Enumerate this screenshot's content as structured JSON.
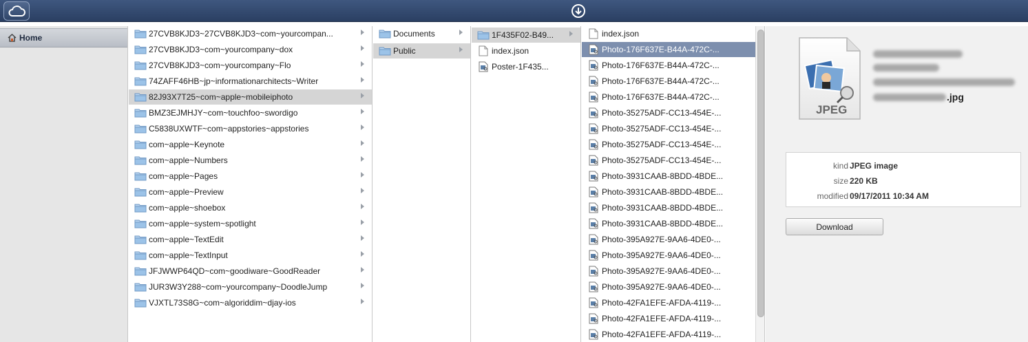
{
  "topbar": {
    "cloud_icon": "cloud-icon",
    "download_icon": "download-circle-icon"
  },
  "sidebar": {
    "home_label": "Home",
    "home_icon": "home-icon"
  },
  "columns": {
    "col1": {
      "selected_index": 4,
      "items": [
        "27CVB8KJD3~27CVB8KJD3~com~yourcompan...",
        "27CVB8KJD3~com~yourcompany~dox",
        "27CVB8KJD3~com~yourcompany~Flo",
        "74ZAFF46HB~jp~informationarchitects~Writer",
        "82J93X7T25~com~apple~mobileiphoto",
        "BMZ3EJMHJY~com~touchfoo~swordigo",
        "C5838UXWTF~com~appstories~appstories",
        "com~apple~Keynote",
        "com~apple~Numbers",
        "com~apple~Pages",
        "com~apple~Preview",
        "com~apple~shoebox",
        "com~apple~system~spotlight",
        "com~apple~TextEdit",
        "com~apple~TextInput",
        "JFJWWP64QD~com~goodiware~GoodReader",
        "JUR3W3Y288~com~yourcompany~DoodleJump",
        "VJXTL73S8G~com~algoriddim~djay-ios"
      ]
    },
    "col2": {
      "selected_index": 1,
      "items": [
        "Documents",
        "Public"
      ]
    },
    "col3": {
      "items": [
        {
          "label": "1F435F02-B49...",
          "kind": "folder"
        },
        {
          "label": "index.json",
          "kind": "file"
        },
        {
          "label": "Poster-1F435...",
          "kind": "image"
        }
      ]
    },
    "col4": {
      "selected_index": 1,
      "items": [
        {
          "label": "index.json",
          "kind": "file"
        },
        {
          "label": "Photo-176F637E-B44A-472C-...",
          "kind": "image"
        },
        {
          "label": "Photo-176F637E-B44A-472C-...",
          "kind": "image"
        },
        {
          "label": "Photo-176F637E-B44A-472C-...",
          "kind": "image"
        },
        {
          "label": "Photo-176F637E-B44A-472C-...",
          "kind": "image"
        },
        {
          "label": "Photo-35275ADF-CC13-454E-...",
          "kind": "image"
        },
        {
          "label": "Photo-35275ADF-CC13-454E-...",
          "kind": "image"
        },
        {
          "label": "Photo-35275ADF-CC13-454E-...",
          "kind": "image"
        },
        {
          "label": "Photo-35275ADF-CC13-454E-...",
          "kind": "image"
        },
        {
          "label": "Photo-3931CAAB-8BDD-4BDE...",
          "kind": "image"
        },
        {
          "label": "Photo-3931CAAB-8BDD-4BDE...",
          "kind": "image"
        },
        {
          "label": "Photo-3931CAAB-8BDD-4BDE...",
          "kind": "image"
        },
        {
          "label": "Photo-3931CAAB-8BDD-4BDE...",
          "kind": "image"
        },
        {
          "label": "Photo-395A927E-9AA6-4DE0-...",
          "kind": "image"
        },
        {
          "label": "Photo-395A927E-9AA6-4DE0-...",
          "kind": "image"
        },
        {
          "label": "Photo-395A927E-9AA6-4DE0-...",
          "kind": "image"
        },
        {
          "label": "Photo-395A927E-9AA6-4DE0-...",
          "kind": "image"
        },
        {
          "label": "Photo-42FA1EFE-AFDA-4119-...",
          "kind": "image"
        },
        {
          "label": "Photo-42FA1EFE-AFDA-4119-...",
          "kind": "image"
        },
        {
          "label": "Photo-42FA1EFE-AFDA-4119-...",
          "kind": "image"
        }
      ]
    }
  },
  "preview": {
    "badge": "JPEG",
    "filename_suffix": ".jpg",
    "meta": {
      "kind_label": "kind",
      "kind_value": "JPEG image",
      "size_label": "size",
      "size_value": "220 KB",
      "modified_label": "modified",
      "modified_value": "09/17/2011 10:34 AM"
    },
    "download_label": "Download"
  },
  "colors": {
    "topbar": "#2f4569",
    "selection_gray": "#d5d5d5",
    "selection_blue": "#7d8fae",
    "folder_blue": "#9cc3e8"
  }
}
